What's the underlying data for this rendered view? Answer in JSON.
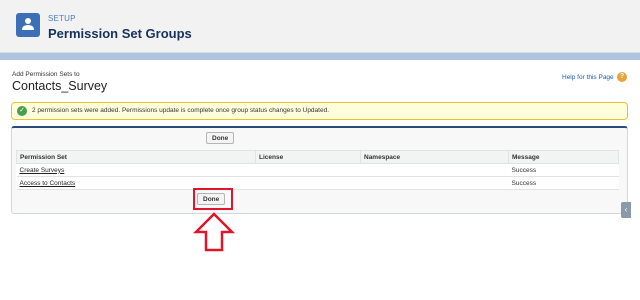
{
  "header": {
    "setup_label": "SETUP",
    "title": "Permission Set Groups",
    "icon": "user-group-icon"
  },
  "page": {
    "subtitle": "Add Permission Sets to",
    "title": "Contacts_Survey",
    "help_link": "Help for this Page",
    "help_icon": "?"
  },
  "message": {
    "text": "2 permission sets were added. Permissions update is complete once group status changes to Updated.",
    "icon": "check-icon"
  },
  "buttons": {
    "done_top": "Done",
    "done_bottom": "Done"
  },
  "table": {
    "columns": [
      "Permission Set",
      "License",
      "Namespace",
      "Message"
    ],
    "rows": [
      {
        "permission_set": "Create Surveys",
        "license": "",
        "namespace": "",
        "message": "Success"
      },
      {
        "permission_set": "Access to Contacts",
        "license": "",
        "namespace": "",
        "message": "Success"
      }
    ]
  },
  "colors": {
    "accent": "#3b6fb6",
    "highlight": "#e0142a",
    "success": "#44a04a",
    "message_bg": "#ffffdc"
  }
}
